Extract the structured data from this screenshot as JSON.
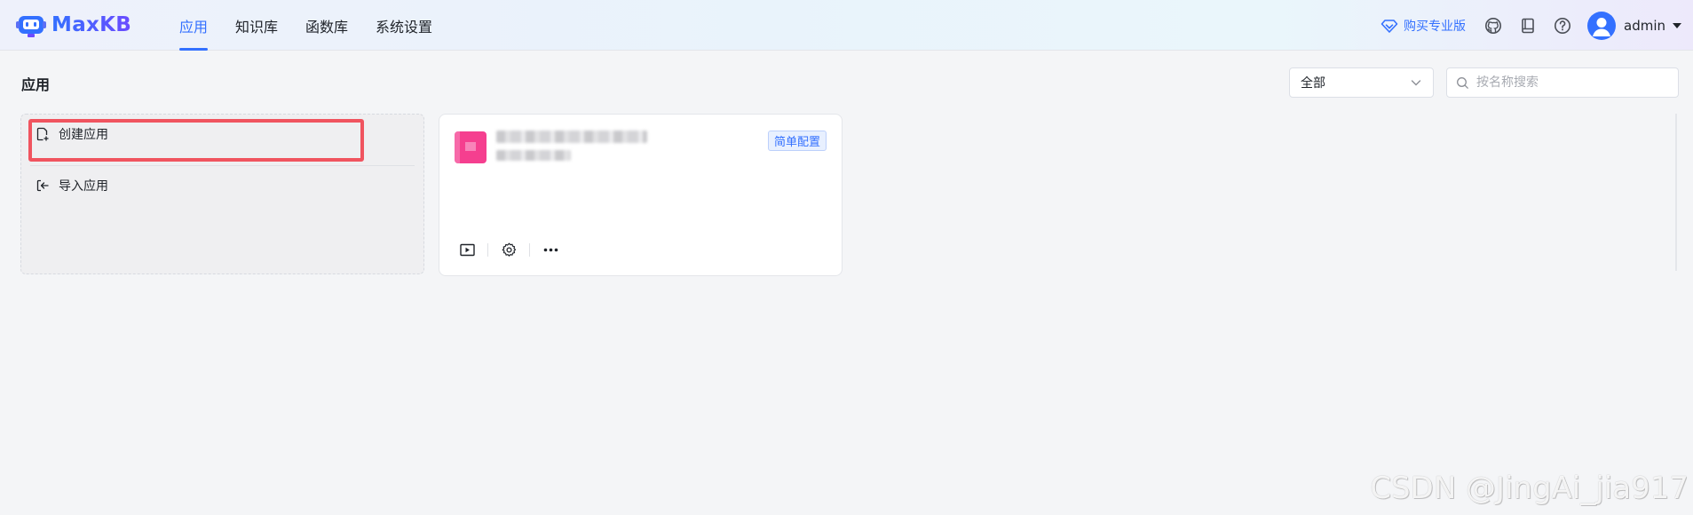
{
  "header": {
    "logo_text": "MaxKB",
    "nav": [
      {
        "label": "应用",
        "active": true
      },
      {
        "label": "知识库",
        "active": false
      },
      {
        "label": "函数库",
        "active": false
      },
      {
        "label": "系统设置",
        "active": false
      }
    ],
    "buy_pro_label": "购买专业版",
    "icons": [
      "github-icon",
      "document-icon",
      "help-icon"
    ],
    "username": "admin"
  },
  "page": {
    "title": "应用",
    "filter": {
      "selected": "全部"
    },
    "search": {
      "placeholder": "按名称搜索",
      "value": ""
    }
  },
  "create_card": {
    "create_label": "创建应用",
    "import_label": "导入应用"
  },
  "app_card": {
    "tag": "简单配置",
    "actions": [
      "play-icon",
      "gear-icon",
      "more-icon"
    ]
  },
  "watermark": "CSDN @JingAi_jia917",
  "colors": {
    "accent": "#3370ff",
    "highlight": "#f0545f",
    "app_avatar": "#f53f8f",
    "background": "#f4f5f7"
  }
}
